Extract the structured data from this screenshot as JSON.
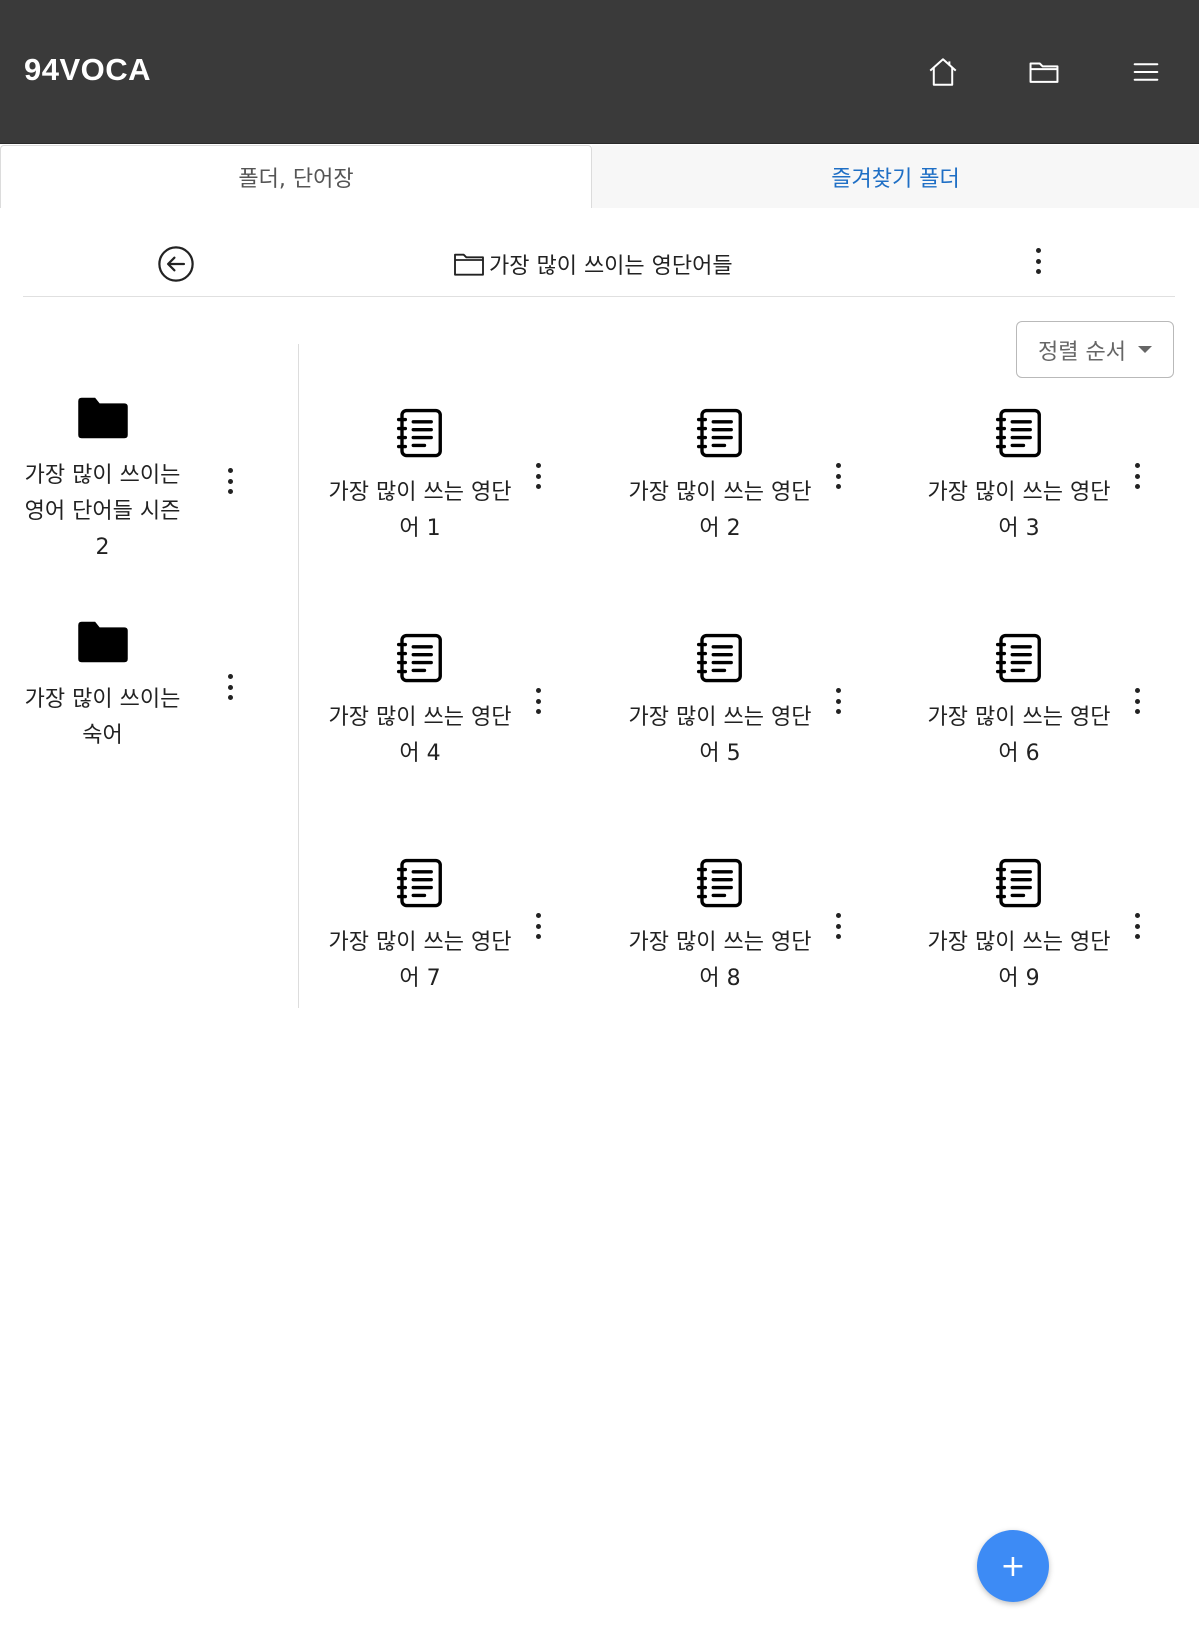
{
  "app": {
    "title": "94VOCA"
  },
  "topbar": {
    "icons": [
      "home-icon",
      "folder-icon",
      "menu-icon"
    ]
  },
  "tabs": [
    {
      "label": "폴더, 단어장"
    },
    {
      "label": "즐겨찾기 폴더"
    }
  ],
  "folder_header": {
    "current_folder": "가장 많이 쓰이는 영단어들"
  },
  "sort": {
    "label": "정렬 순서"
  },
  "folders": [
    {
      "label": "가장 많이 쓰이는 영어 단어들 시즌2"
    },
    {
      "label": "가장 많이 쓰이는 숙어"
    }
  ],
  "wordbooks": [
    {
      "label": "가장 많이 쓰는 영단어 1"
    },
    {
      "label": "가장 많이 쓰는 영단어 2"
    },
    {
      "label": "가장 많이 쓰는 영단어 3"
    },
    {
      "label": "가장 많이 쓰는 영단어 4"
    },
    {
      "label": "가장 많이 쓰는 영단어 5"
    },
    {
      "label": "가장 많이 쓰는 영단어 6"
    },
    {
      "label": "가장 많이 쓰는 영단어 7"
    },
    {
      "label": "가장 많이 쓰는 영단어 8"
    },
    {
      "label": "가장 많이 쓰는 영단어 9"
    }
  ],
  "fab": {
    "label": "+"
  },
  "colors": {
    "topbar": "#3a3a3a",
    "accent": "#1f6fc5",
    "fab": "#3d8bf5"
  }
}
